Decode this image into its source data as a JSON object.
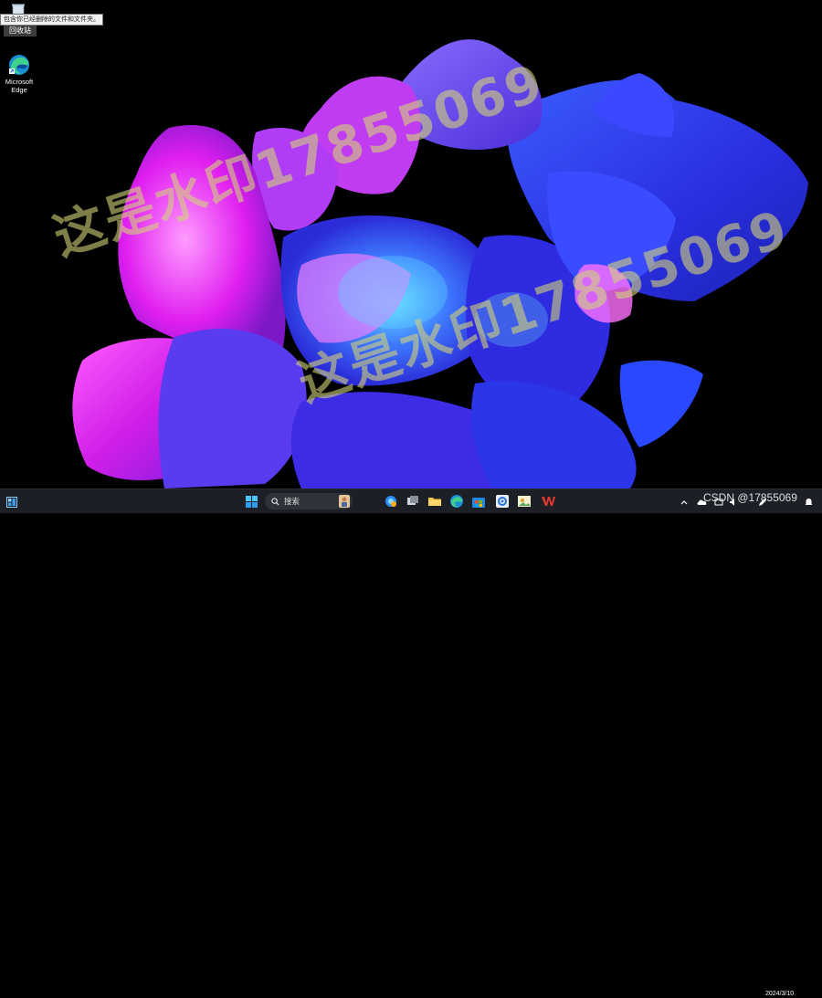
{
  "desktop": {
    "tooltip_text": "包含你已经删除的文件和文件夹。",
    "recycle_bin_label": "回收站",
    "edge_label_line1": "Microsoft",
    "edge_label_line2": "Edge",
    "watermark_text": "这是水印17855069"
  },
  "taskbar": {
    "search_placeholder": "搜索",
    "date": "2024/3/10",
    "csdn_text": "CSDN @17855069",
    "chevron": "^"
  },
  "colors": {
    "taskbar_bg": "#1c1f26",
    "start_blue": "#3a9ff0",
    "watermark": "#d2d278"
  }
}
